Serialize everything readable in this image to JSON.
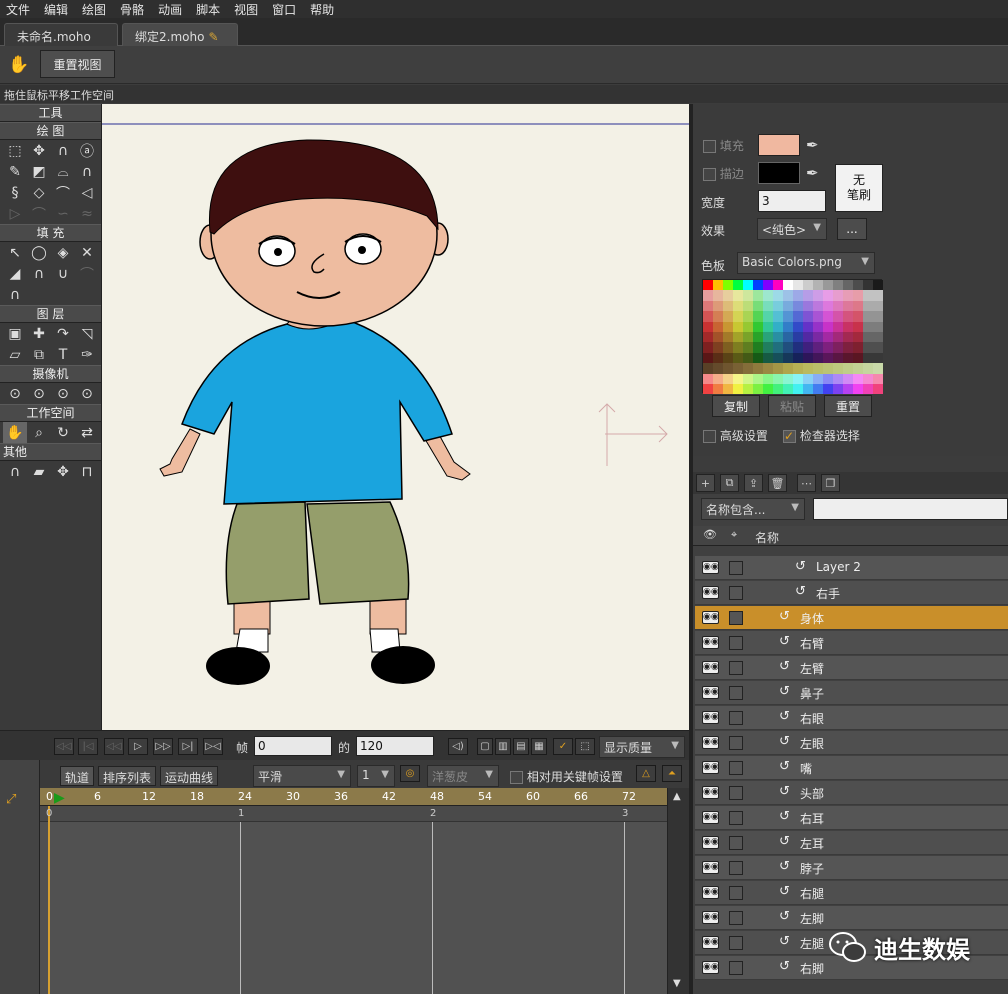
{
  "menu": [
    "文件",
    "编辑",
    "绘图",
    "骨骼",
    "动画",
    "脚本",
    "视图",
    "窗口",
    "帮助"
  ],
  "tabs": [
    {
      "label": "未命名.moho"
    },
    {
      "label": "绑定2.moho"
    }
  ],
  "toolbar": {
    "reset_view": "重置视图"
  },
  "status": {
    "hint": "拖住鼠标平移工作空间"
  },
  "tools": {
    "title": "工具",
    "sections": {
      "draw": "绘 图",
      "fill": "填 充",
      "layer": "图 层",
      "camera": "摄像机",
      "workspace": "工作空间",
      "other": "其他"
    }
  },
  "style": {
    "fill_label": "填充",
    "stroke_label": "描边",
    "width_label": "宽度",
    "width_value": "3",
    "no_brush": "无\n笔刷",
    "effect_label": "效果",
    "effect_value": "<纯色>",
    "more": "...",
    "palette_label": "色板",
    "palette_value": "Basic Colors.png",
    "copy": "复制",
    "paste": "粘贴",
    "reset": "重置",
    "advanced": "高级设置",
    "inspector": "检查器选择",
    "fill_color": "#f0b8a0",
    "stroke_color": "#000000"
  },
  "layers": {
    "filter_label": "名称包含...",
    "header_name": "名称",
    "rows": [
      {
        "name": "Layer 2",
        "indent": 2,
        "selected": false
      },
      {
        "name": "右手",
        "indent": 2,
        "selected": false
      },
      {
        "name": "身体",
        "indent": 1,
        "selected": true
      },
      {
        "name": "右臂",
        "indent": 1,
        "selected": false
      },
      {
        "name": "左臂",
        "indent": 1,
        "selected": false
      },
      {
        "name": "鼻子",
        "indent": 1,
        "selected": false
      },
      {
        "name": "右眼",
        "indent": 1,
        "selected": false
      },
      {
        "name": "左眼",
        "indent": 1,
        "selected": false
      },
      {
        "name": "嘴",
        "indent": 1,
        "selected": false
      },
      {
        "name": "头部",
        "indent": 1,
        "selected": false
      },
      {
        "name": "右耳",
        "indent": 1,
        "selected": false
      },
      {
        "name": "左耳",
        "indent": 1,
        "selected": false
      },
      {
        "name": "脖子",
        "indent": 1,
        "selected": false
      },
      {
        "name": "右腿",
        "indent": 1,
        "selected": false
      },
      {
        "name": "左脚",
        "indent": 1,
        "selected": false
      },
      {
        "name": "左腿",
        "indent": 1,
        "selected": false
      },
      {
        "name": "右脚",
        "indent": 1,
        "selected": false
      }
    ]
  },
  "playback": {
    "frame_label": "帧",
    "frame_value": "0",
    "of_label": "的",
    "total_value": "120",
    "quality": "显示质量"
  },
  "timeline": {
    "tabs": [
      "轨道",
      "排序列表",
      "运动曲线"
    ],
    "interp": "平滑",
    "step": "1",
    "onion": "洋葱皮",
    "relative": "相对用关键帧设置",
    "ruler": [
      "0",
      "6",
      "12",
      "18",
      "24",
      "30",
      "36",
      "42",
      "48",
      "54",
      "60",
      "66",
      "72"
    ],
    "seconds": [
      "0",
      "1",
      "2",
      "3"
    ]
  },
  "watermark": "迪生数娱"
}
